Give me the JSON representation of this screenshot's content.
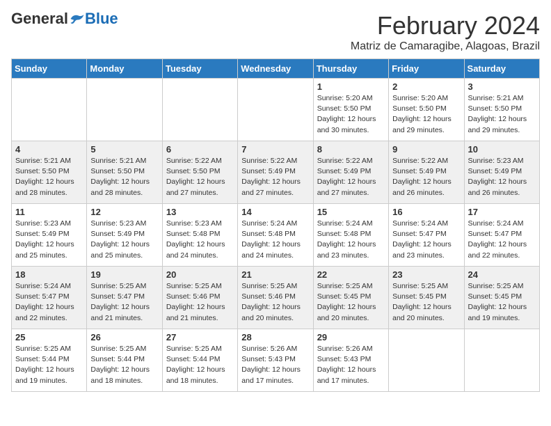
{
  "logo": {
    "general": "General",
    "blue": "Blue"
  },
  "title": "February 2024",
  "location": "Matriz de Camaragibe, Alagoas, Brazil",
  "days_of_week": [
    "Sunday",
    "Monday",
    "Tuesday",
    "Wednesday",
    "Thursday",
    "Friday",
    "Saturday"
  ],
  "weeks": [
    [
      {
        "day": "",
        "info": ""
      },
      {
        "day": "",
        "info": ""
      },
      {
        "day": "",
        "info": ""
      },
      {
        "day": "",
        "info": ""
      },
      {
        "day": "1",
        "info": "Sunrise: 5:20 AM\nSunset: 5:50 PM\nDaylight: 12 hours\nand 30 minutes."
      },
      {
        "day": "2",
        "info": "Sunrise: 5:20 AM\nSunset: 5:50 PM\nDaylight: 12 hours\nand 29 minutes."
      },
      {
        "day": "3",
        "info": "Sunrise: 5:21 AM\nSunset: 5:50 PM\nDaylight: 12 hours\nand 29 minutes."
      }
    ],
    [
      {
        "day": "4",
        "info": "Sunrise: 5:21 AM\nSunset: 5:50 PM\nDaylight: 12 hours\nand 28 minutes."
      },
      {
        "day": "5",
        "info": "Sunrise: 5:21 AM\nSunset: 5:50 PM\nDaylight: 12 hours\nand 28 minutes."
      },
      {
        "day": "6",
        "info": "Sunrise: 5:22 AM\nSunset: 5:50 PM\nDaylight: 12 hours\nand 27 minutes."
      },
      {
        "day": "7",
        "info": "Sunrise: 5:22 AM\nSunset: 5:49 PM\nDaylight: 12 hours\nand 27 minutes."
      },
      {
        "day": "8",
        "info": "Sunrise: 5:22 AM\nSunset: 5:49 PM\nDaylight: 12 hours\nand 27 minutes."
      },
      {
        "day": "9",
        "info": "Sunrise: 5:22 AM\nSunset: 5:49 PM\nDaylight: 12 hours\nand 26 minutes."
      },
      {
        "day": "10",
        "info": "Sunrise: 5:23 AM\nSunset: 5:49 PM\nDaylight: 12 hours\nand 26 minutes."
      }
    ],
    [
      {
        "day": "11",
        "info": "Sunrise: 5:23 AM\nSunset: 5:49 PM\nDaylight: 12 hours\nand 25 minutes."
      },
      {
        "day": "12",
        "info": "Sunrise: 5:23 AM\nSunset: 5:49 PM\nDaylight: 12 hours\nand 25 minutes."
      },
      {
        "day": "13",
        "info": "Sunrise: 5:23 AM\nSunset: 5:48 PM\nDaylight: 12 hours\nand 24 minutes."
      },
      {
        "day": "14",
        "info": "Sunrise: 5:24 AM\nSunset: 5:48 PM\nDaylight: 12 hours\nand 24 minutes."
      },
      {
        "day": "15",
        "info": "Sunrise: 5:24 AM\nSunset: 5:48 PM\nDaylight: 12 hours\nand 23 minutes."
      },
      {
        "day": "16",
        "info": "Sunrise: 5:24 AM\nSunset: 5:47 PM\nDaylight: 12 hours\nand 23 minutes."
      },
      {
        "day": "17",
        "info": "Sunrise: 5:24 AM\nSunset: 5:47 PM\nDaylight: 12 hours\nand 22 minutes."
      }
    ],
    [
      {
        "day": "18",
        "info": "Sunrise: 5:24 AM\nSunset: 5:47 PM\nDaylight: 12 hours\nand 22 minutes."
      },
      {
        "day": "19",
        "info": "Sunrise: 5:25 AM\nSunset: 5:47 PM\nDaylight: 12 hours\nand 21 minutes."
      },
      {
        "day": "20",
        "info": "Sunrise: 5:25 AM\nSunset: 5:46 PM\nDaylight: 12 hours\nand 21 minutes."
      },
      {
        "day": "21",
        "info": "Sunrise: 5:25 AM\nSunset: 5:46 PM\nDaylight: 12 hours\nand 20 minutes."
      },
      {
        "day": "22",
        "info": "Sunrise: 5:25 AM\nSunset: 5:45 PM\nDaylight: 12 hours\nand 20 minutes."
      },
      {
        "day": "23",
        "info": "Sunrise: 5:25 AM\nSunset: 5:45 PM\nDaylight: 12 hours\nand 20 minutes."
      },
      {
        "day": "24",
        "info": "Sunrise: 5:25 AM\nSunset: 5:45 PM\nDaylight: 12 hours\nand 19 minutes."
      }
    ],
    [
      {
        "day": "25",
        "info": "Sunrise: 5:25 AM\nSunset: 5:44 PM\nDaylight: 12 hours\nand 19 minutes."
      },
      {
        "day": "26",
        "info": "Sunrise: 5:25 AM\nSunset: 5:44 PM\nDaylight: 12 hours\nand 18 minutes."
      },
      {
        "day": "27",
        "info": "Sunrise: 5:25 AM\nSunset: 5:44 PM\nDaylight: 12 hours\nand 18 minutes."
      },
      {
        "day": "28",
        "info": "Sunrise: 5:26 AM\nSunset: 5:43 PM\nDaylight: 12 hours\nand 17 minutes."
      },
      {
        "day": "29",
        "info": "Sunrise: 5:26 AM\nSunset: 5:43 PM\nDaylight: 12 hours\nand 17 minutes."
      },
      {
        "day": "",
        "info": ""
      },
      {
        "day": "",
        "info": ""
      }
    ]
  ]
}
